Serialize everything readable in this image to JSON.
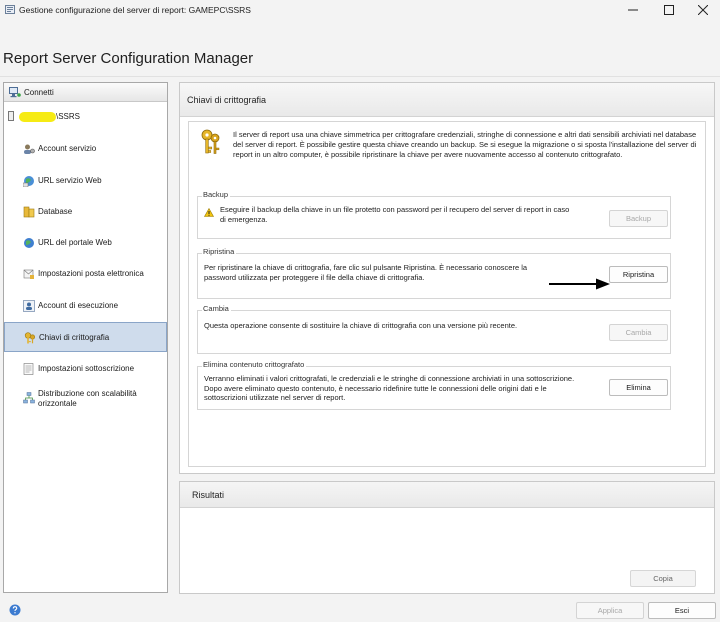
{
  "window": {
    "title": "Gestione configurazione del server di report: GAMEPC\\SSRS",
    "minimize_icon": "minimize-icon",
    "maximize_icon": "maximize-icon",
    "close_icon": "close-icon"
  },
  "header": {
    "title": "Report Server Configuration Manager"
  },
  "sidebar": {
    "connect_label": "Connetti",
    "server_name": "\\SSRS",
    "items": [
      {
        "label": "Account servizio",
        "icon": "service-account-icon"
      },
      {
        "label": "URL servizio Web",
        "icon": "web-service-url-icon"
      },
      {
        "label": "Database",
        "icon": "database-icon"
      },
      {
        "label": "URL del portale Web",
        "icon": "web-portal-url-icon"
      },
      {
        "label": "Impostazioni posta elettronica",
        "icon": "email-settings-icon"
      },
      {
        "label": "Account di esecuzione",
        "icon": "execution-account-icon"
      },
      {
        "label": "Chiavi di crittografia",
        "icon": "encryption-keys-icon",
        "active": true
      },
      {
        "label": "Impostazioni sottoscrizione",
        "icon": "subscription-settings-icon"
      },
      {
        "label": "Distribuzione con scalabilità orizzontale",
        "icon": "scale-out-icon"
      }
    ]
  },
  "main": {
    "title": "Chiavi di crittografia",
    "intro": "Il server di report usa una chiave simmetrica per crittografare credenziali, stringhe di connessione e altri dati sensibili archiviati nel database del server di report. È possibile gestire questa chiave creando un backup. Se si esegue la migrazione o si sposta l'installazione del server di report in un altro computer, è possibile ripristinare la chiave per avere nuovamente accesso al contenuto crittografato.",
    "backup": {
      "title": "Backup",
      "text": "Eseguire il backup della chiave in un file protetto con password per il recupero del server di report in caso di emergenza.",
      "button": "Backup"
    },
    "restore": {
      "title": "Ripristina",
      "text": "Per ripristinare la chiave di crittografia, fare clic sul pulsante Ripristina. È necessario conoscere la password utilizzata per proteggere il file della chiave di crittografia.",
      "button": "Ripristina"
    },
    "change": {
      "title": "Cambia",
      "text": "Questa operazione consente di sostituire la chiave di crittografia con una versione più recente.",
      "button": "Cambia"
    },
    "delete": {
      "title": "Elimina contenuto crittografato",
      "text": "Verranno eliminati i valori crittografati, le credenziali e le stringhe di connessione archiviati in una sottoscrizione. Dopo avere eliminato questo contenuto, è necessario ridefinire tutte le connessioni delle origini dati e le sottoscrizioni utilizzate nel server di report.",
      "button": "Elimina"
    }
  },
  "results": {
    "title": "Risultati",
    "copy_button": "Copia"
  },
  "footer": {
    "apply_button": "Applica",
    "exit_button": "Esci"
  }
}
